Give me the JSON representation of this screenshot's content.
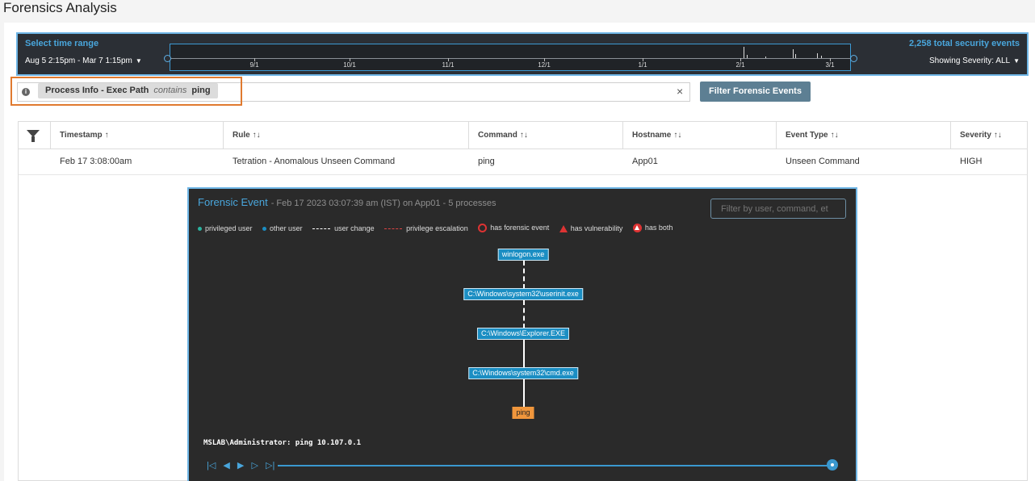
{
  "page": {
    "title": "Forensics Analysis"
  },
  "time_range": {
    "label": "Select time range",
    "range": "Aug 5 2:15pm - Mar 7 1:15pm",
    "total_events": "2,258 total security events",
    "severity": "Showing Severity: ALL",
    "ticks": [
      "9/1",
      "10/1",
      "11/1",
      "12/1",
      "1/1",
      "2/1",
      "3/1"
    ]
  },
  "filter": {
    "chip_key": "Process Info - Exec Path",
    "chip_operator": "contains",
    "chip_value": "ping",
    "clear_symbol": "×",
    "button_label": "Filter Forensic Events"
  },
  "table": {
    "columns": [
      "Timestamp",
      "Rule",
      "Command",
      "Hostname",
      "Event Type",
      "Severity"
    ],
    "sort_asc": "↑",
    "sort_both": "↑↓",
    "rows": [
      {
        "timestamp": "Feb 17 3:08:00am",
        "rule": "Tetration - Anomalous Unseen Command",
        "command": "ping",
        "hostname": "App01",
        "event_type": "Unseen Command",
        "severity": "HIGH"
      }
    ]
  },
  "forensic_event": {
    "title": "Forensic Event",
    "subtitle": "- Feb 17 2023 03:07:39 am (IST) on App01 - 5 processes",
    "search_placeholder": "Filter by user, command, et",
    "legend": {
      "privileged_user": "privileged user",
      "other_user": "other user",
      "user_change": "user change",
      "privilege_escalation": "privilege escalation",
      "has_forensic_event": "has forensic event",
      "has_vulnerability": "has vulnerability",
      "has_both": "has both"
    },
    "nodes": [
      "winlogon.exe",
      "C:\\Windows\\system32\\userinit.exe",
      "C:\\Windows\\Explorer.EXE",
      "C:\\Windows\\system32\\cmd.exe",
      "ping"
    ],
    "command_line": "MSLAB\\Administrator: ping 10.107.0.1",
    "player": {
      "first": "|◁",
      "prev": "◀",
      "play": "▶",
      "next": "▷",
      "last": "▷|"
    }
  },
  "colors": {
    "accent": "#49a6dc",
    "highlight": "#e07a2f",
    "node": "#1b8ec3",
    "ping_node": "#f0963c",
    "privileged_user": "#2ab3a0",
    "other_user": "#1b8ec3"
  }
}
